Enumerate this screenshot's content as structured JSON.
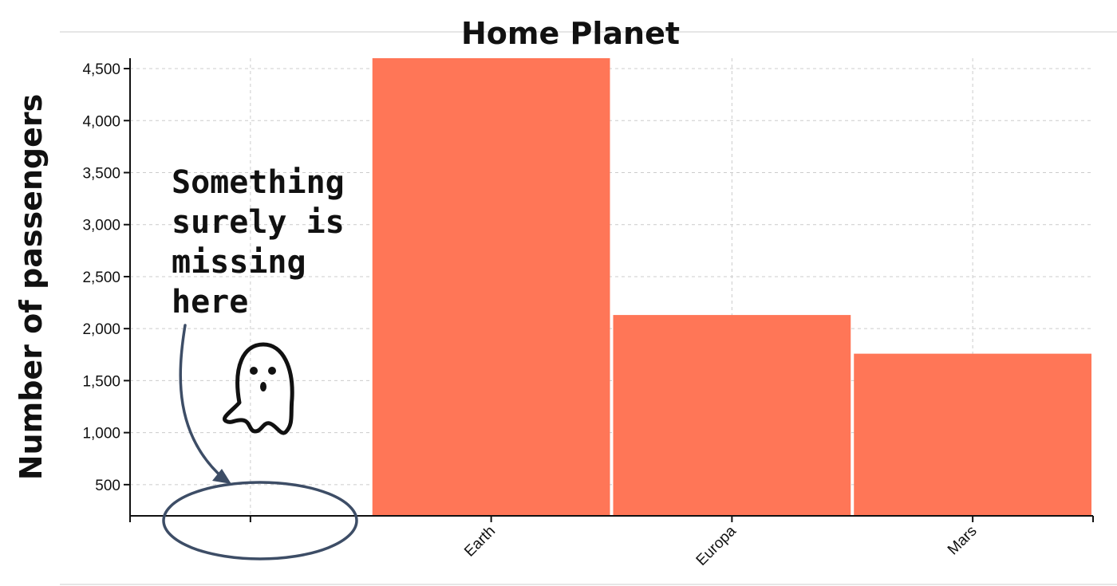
{
  "chart_data": {
    "type": "bar",
    "title": "Home Planet",
    "ylabel": "Number of passengers",
    "xlabel": "",
    "categories": [
      "",
      "Earth",
      "Europa",
      "Mars"
    ],
    "values": [
      0,
      4602,
      2131,
      1759
    ],
    "ylim": [
      200,
      4600
    ],
    "yticks": [
      500,
      1000,
      1500,
      2000,
      2500,
      3000,
      3500,
      4000,
      4500
    ],
    "ytick_labels": [
      "500",
      "1,000",
      "1,500",
      "2,000",
      "2,500",
      "3,000",
      "3,500",
      "4,000",
      "4,500"
    ],
    "grid": true,
    "bar_color": "#ff7657",
    "annotation": {
      "lines": [
        "Something",
        "surely is",
        "missing",
        "here"
      ],
      "color": "#3d4d66",
      "icon": "ghost-icon"
    }
  }
}
